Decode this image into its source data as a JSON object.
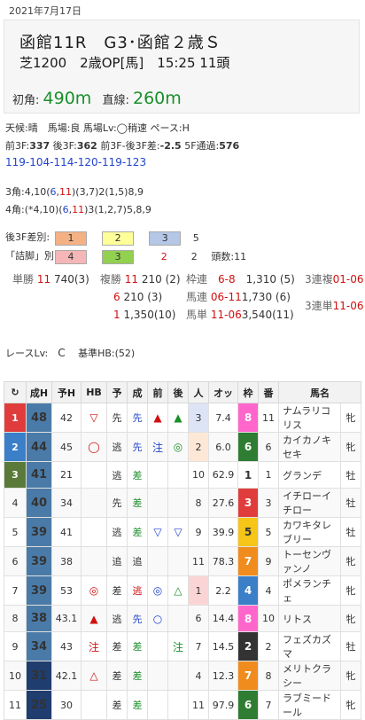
{
  "date": "2021年7月17日",
  "race": {
    "title1": "函館11R　G3･函館２歳Ｓ",
    "title2": "芝1200　2歳OP[馬]　15:25 11頭",
    "first_corner_label": "初角:",
    "first_corner": "490m",
    "straight_label": "直線:",
    "straight": "260m"
  },
  "cond": {
    "line1": "天候:晴　馬場:良 馬場Lv:◯稍速 ペース:H",
    "f3_label": "前3F:",
    "f3": "337",
    "l3_label": "後3F:",
    "l3": "362",
    "diff_label": "前3F-後3F差:",
    "diff": "-2.5",
    "f5_label": "5F通過:",
    "f5": "576",
    "laps": "119-104-114-120-119-123",
    "c3_a": "3角:4,10(",
    "c3_b": "6",
    "c3_c": ",",
    "c3_d": "11",
    "c3_e": ")(3,7)2(1,5)8,9",
    "c4_a": "4角:(*4,10)(",
    "c4_b": "6",
    "c4_c": ",",
    "c4_d": "11",
    "c4_e": ")3(1,2,7)5,8,9"
  },
  "ranks": {
    "row1_label": "後3F差別:",
    "row1": [
      {
        "v": "1",
        "bg": "#f4b183"
      },
      {
        "v": "2",
        "bg": "#ffff99"
      },
      {
        "v": "3",
        "bg": "#b4c7e7"
      },
      {
        "v": "5",
        "bg": "none"
      }
    ],
    "row2_label": "「詰脚」別:",
    "row2": [
      {
        "v": "4",
        "bg": "#f4b6b6"
      },
      {
        "v": "3",
        "bg": "#92d050"
      },
      {
        "v": "2",
        "bg": "none"
      },
      {
        "v": "2",
        "bg": "none"
      }
    ],
    "heads_label": "頭数:",
    "heads": "11"
  },
  "payout": {
    "tan_label": "単勝",
    "tan_num": "11",
    "tan_val": "740",
    "tan_pop": "(3)",
    "fuku_label": "複勝",
    "fuku": [
      {
        "num": "11",
        "val": "210",
        "pop": "(2)"
      },
      {
        "num": "6",
        "val": "210",
        "pop": "(3)"
      },
      {
        "num": "1",
        "val": "1,350",
        "pop": "(10)"
      }
    ],
    "waku_label": "枠連",
    "waku_num": "6-8",
    "waku_val": "1,310",
    "waku_pop": "(5)",
    "umaren_label": "馬連",
    "umaren_num": "06-11",
    "umaren_val": "1,730",
    "umaren_pop": "(6)",
    "umatan_label": "馬単",
    "umatan_num": "11-06",
    "umatan_val": "3,540",
    "umatan_pop": "(11)",
    "sanfuku_label": "3連複",
    "sanfuku_num": "01-06",
    "santan_label": "3連単",
    "santan_num": "11-06"
  },
  "race_lv": {
    "label": "レースLv:",
    "value": "C",
    "std_label": "基準HB:",
    "std": "(52)"
  },
  "table": {
    "headers": [
      "↻",
      "成H",
      "予H",
      "HB",
      "予",
      "成",
      "前",
      "後",
      "人",
      "オッ",
      "枠",
      "番",
      "馬名"
    ],
    "rows": [
      {
        "rank": "1",
        "rank_bg": "#e03c3c",
        "sh": "48",
        "sh_bg": "#4a7ba8",
        "yh": "42",
        "hb": "▽",
        "hb_c": "#d01010",
        "yo": "先",
        "sei": "先",
        "sei_c": "#2244cc",
        "mae": "▲",
        "mae_c": "#d01010",
        "ato": "▲",
        "ato_c": "#1a8f2a",
        "pop": "3",
        "pop_bg": "#dde4f5",
        "odds": "7.4",
        "waku": "8",
        "waku_bg": "#ff66cc",
        "waku_c": "#fff",
        "ban": "11",
        "name": "ナムラリコリス",
        "sex": "牝"
      },
      {
        "rank": "2",
        "rank_bg": "#3a7fc8",
        "sh": "44",
        "sh_bg": "#4a7ba8",
        "yh": "45",
        "hb": "◯",
        "hb_c": "#d01010",
        "yo": "逃",
        "sei": "先",
        "sei_c": "#2244cc",
        "mae": "注",
        "mae_c": "#2244cc",
        "ato": "◎",
        "ato_c": "#1a8f2a",
        "pop": "2",
        "pop_bg": "#fde8d8",
        "odds": "6.0",
        "waku": "6",
        "waku_bg": "#2e7d32",
        "waku_c": "#fff",
        "ban": "6",
        "name": "カイカノキセキ",
        "sex": "牝"
      },
      {
        "rank": "3",
        "rank_bg": "#5a7a3a",
        "sh": "41",
        "sh_bg": "#4a7ba8",
        "yh": "21",
        "hb": "",
        "hb_c": "#333",
        "yo": "逃",
        "sei": "差",
        "sei_c": "#1a8f2a",
        "mae": "",
        "mae_c": "#333",
        "ato": "",
        "ato_c": "#333",
        "pop": "10",
        "pop_bg": "none",
        "odds": "62.9",
        "waku": "1",
        "waku_bg": "#ffffff",
        "waku_c": "#333",
        "ban": "1",
        "name": "グランデ",
        "sex": "牡"
      },
      {
        "rank": "4",
        "rank_bg": "none",
        "sh": "40",
        "sh_bg": "#4a7ba8",
        "yh": "34",
        "hb": "",
        "hb_c": "#333",
        "yo": "先",
        "sei": "差",
        "sei_c": "#1a8f2a",
        "mae": "",
        "mae_c": "#333",
        "ato": "",
        "ato_c": "#333",
        "pop": "8",
        "pop_bg": "none",
        "odds": "27.6",
        "waku": "3",
        "waku_bg": "#e03c3c",
        "waku_c": "#fff",
        "ban": "3",
        "name": "イチローイチロー",
        "sex": "牡"
      },
      {
        "rank": "5",
        "rank_bg": "none",
        "sh": "39",
        "sh_bg": "#4a7ba8",
        "yh": "41",
        "hb": "",
        "hb_c": "#333",
        "yo": "逃",
        "sei": "差",
        "sei_c": "#1a8f2a",
        "mae": "▽",
        "mae_c": "#2244cc",
        "ato": "▽",
        "ato_c": "#2244cc",
        "pop": "9",
        "pop_bg": "none",
        "odds": "39.9",
        "waku": "5",
        "waku_bg": "#f5c518",
        "waku_c": "#333",
        "ban": "5",
        "name": "カワキタレブリー",
        "sex": "牡"
      },
      {
        "rank": "6",
        "rank_bg": "none",
        "sh": "39",
        "sh_bg": "#4a7ba8",
        "yh": "38",
        "hb": "",
        "hb_c": "#333",
        "yo": "追",
        "sei": "追",
        "sei_c": "#333",
        "mae": "",
        "mae_c": "#333",
        "ato": "",
        "ato_c": "#333",
        "pop": "11",
        "pop_bg": "none",
        "odds": "78.3",
        "waku": "7",
        "waku_bg": "#f08c1e",
        "waku_c": "#fff",
        "ban": "9",
        "name": "トーセンヴァンノ",
        "sex": "牝"
      },
      {
        "rank": "7",
        "rank_bg": "none",
        "sh": "39",
        "sh_bg": "#4a7ba8",
        "yh": "53",
        "hb": "◎",
        "hb_c": "#d01010",
        "yo": "差",
        "sei": "逃",
        "sei_c": "#d01010",
        "mae": "◎",
        "mae_c": "#2244cc",
        "ato": "△",
        "ato_c": "#1a8f2a",
        "pop": "1",
        "pop_bg": "#fbd5d5",
        "odds": "2.2",
        "waku": "4",
        "waku_bg": "#3a7fc8",
        "waku_c": "#fff",
        "ban": "4",
        "name": "ポメランチェ",
        "sex": "牝"
      },
      {
        "rank": "8",
        "rank_bg": "none",
        "sh": "38",
        "sh_bg": "#4a7ba8",
        "yh": "43.1",
        "hb": "▲",
        "hb_c": "#d01010",
        "yo": "逃",
        "sei": "先",
        "sei_c": "#2244cc",
        "mae": "○",
        "mae_c": "#2244cc",
        "ato": "",
        "ato_c": "#333",
        "pop": "6",
        "pop_bg": "none",
        "odds": "14.4",
        "waku": "8",
        "waku_bg": "#ff66cc",
        "waku_c": "#fff",
        "ban": "10",
        "name": "リトス",
        "sex": "牝"
      },
      {
        "rank": "9",
        "rank_bg": "none",
        "sh": "34",
        "sh_bg": "#4a7ba8",
        "yh": "43",
        "hb": "注",
        "hb_c": "#d01010",
        "yo": "差",
        "sei": "差",
        "sei_c": "#1a8f2a",
        "mae": "",
        "mae_c": "#333",
        "ato": "注",
        "ato_c": "#1a8f2a",
        "pop": "7",
        "pop_bg": "none",
        "odds": "14.5",
        "waku": "2",
        "waku_bg": "#333333",
        "waku_c": "#fff",
        "ban": "2",
        "name": "フェズカズマ",
        "sex": "牡"
      },
      {
        "rank": "10",
        "rank_bg": "none",
        "sh": "31",
        "sh_bg": "#1f3d6e",
        "yh": "42.1",
        "hb": "△",
        "hb_c": "#d01010",
        "yo": "差",
        "sei": "差",
        "sei_c": "#1a8f2a",
        "mae": "",
        "mae_c": "#333",
        "ato": "",
        "ato_c": "#333",
        "pop": "4",
        "pop_bg": "none",
        "odds": "12.3",
        "waku": "7",
        "waku_bg": "#f08c1e",
        "waku_c": "#fff",
        "ban": "8",
        "name": "メリトクラシー",
        "sex": "牝"
      },
      {
        "rank": "11",
        "rank_bg": "none",
        "sh": "25",
        "sh_bg": "#1f3d6e",
        "yh": "30",
        "hb": "",
        "hb_c": "#333",
        "yo": "差",
        "sei": "差",
        "sei_c": "#1a8f2a",
        "mae": "",
        "mae_c": "#333",
        "ato": "",
        "ato_c": "#333",
        "pop": "11",
        "pop_bg": "none",
        "odds": "97.9",
        "waku": "6",
        "waku_bg": "#2e7d32",
        "waku_c": "#fff",
        "ban": "7",
        "name": "ラブミードール",
        "sex": "牝"
      }
    ]
  }
}
